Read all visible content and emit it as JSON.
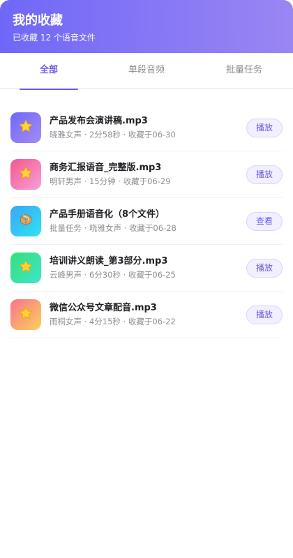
{
  "header": {
    "title": "我的收藏",
    "subtitle": "已收藏 12 个语音文件"
  },
  "tabs": [
    {
      "label": "全部",
      "active": true
    },
    {
      "label": "单段音频",
      "active": false
    },
    {
      "label": "批量任务",
      "active": false
    }
  ],
  "items": [
    {
      "name": "产品发布会演讲稿.mp3",
      "info": "晓雅女声 · 2分58秒 · 收藏于06-30",
      "action": "播放",
      "icon": "star-icon",
      "gradient": [
        "#6f67f7",
        "#a38cf5"
      ]
    },
    {
      "name": "商务汇报语音_完整版.mp3",
      "info": "明轩男声 · 15分钟 · 收藏于06-29",
      "action": "播放",
      "icon": "star-icon",
      "gradient": [
        "#f2578f",
        "#f7a0d8"
      ]
    },
    {
      "name": "产品手册语音化（8个文件）",
      "info": "批量任务 · 晓雅女声 · 收藏于06-28",
      "action": "查看",
      "icon": "package-icon",
      "gradient": [
        "#3aa6f6",
        "#2ee3f3"
      ]
    },
    {
      "name": "培训讲义朗读_第3部分.mp3",
      "info": "云峰男声 · 6分30秒 · 收藏于06-25",
      "action": "播放",
      "icon": "star-icon",
      "gradient": [
        "#35e07a",
        "#3ee6c9"
      ]
    },
    {
      "name": "微信公众号文章配音.mp3",
      "info": "雨桐女声 · 4分15秒 · 收藏于06-22",
      "action": "播放",
      "icon": "star-icon",
      "gradient": [
        "#f7738e",
        "#fbd15a"
      ]
    }
  ]
}
